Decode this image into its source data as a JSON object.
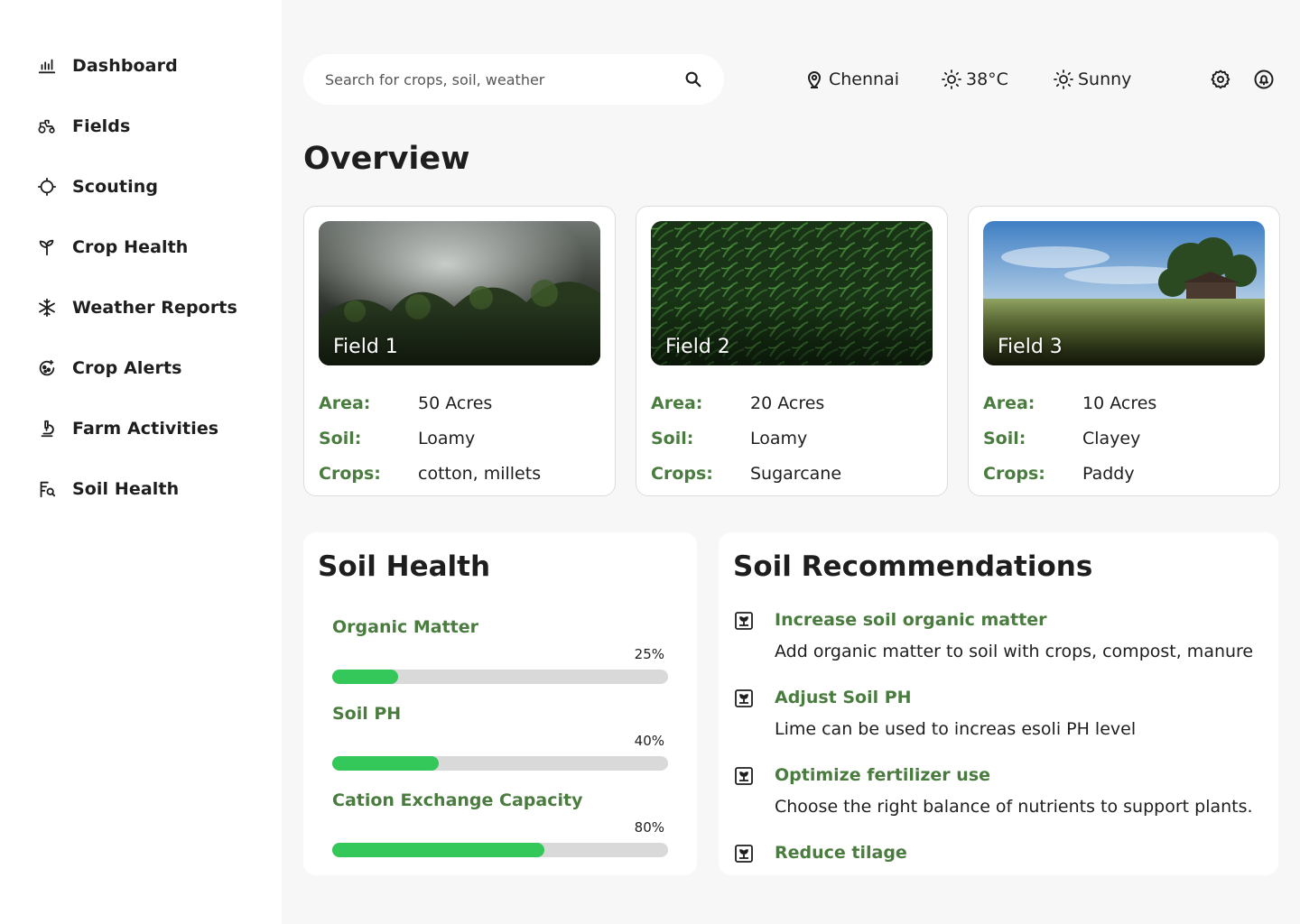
{
  "sidebar": {
    "items": [
      {
        "label": "Dashboard",
        "icon": "bar-chart-icon"
      },
      {
        "label": "Fields",
        "icon": "tractor-icon"
      },
      {
        "label": "Scouting",
        "icon": "crosshair-icon"
      },
      {
        "label": "Crop Health",
        "icon": "sprout-icon"
      },
      {
        "label": "Weather Reports",
        "icon": "snowflake-icon"
      },
      {
        "label": "Crop Alerts",
        "icon": "alert-icon"
      },
      {
        "label": "Farm Activities",
        "icon": "microscope-icon"
      },
      {
        "label": "Soil Health",
        "icon": "soil-search-icon"
      }
    ]
  },
  "search": {
    "placeholder": "Search for crops, soil, weather"
  },
  "header": {
    "location": "Chennai",
    "temperature": "38°C",
    "condition": "Sunny"
  },
  "overview": {
    "title": "Overview"
  },
  "fields": [
    {
      "name": "Field 1",
      "area_key": "Area:",
      "area": "50 Acres",
      "soil_key": "Soil:",
      "soil": "Loamy",
      "crops_key": "Crops:",
      "crops": "cotton, millets"
    },
    {
      "name": "Field 2",
      "area_key": "Area:",
      "area": "20 Acres",
      "soil_key": "Soil:",
      "soil": "Loamy",
      "crops_key": "Crops:",
      "crops": "Sugarcane"
    },
    {
      "name": "Field 3",
      "area_key": "Area:",
      "area": "10 Acres",
      "soil_key": "Soil:",
      "soil": "Clayey",
      "crops_key": "Crops:",
      "crops": "Paddy"
    }
  ],
  "soil_health": {
    "title": "Soil Health",
    "metrics": [
      {
        "label": "Organic Matter",
        "percent": "25%",
        "value": 25
      },
      {
        "label": "Soil PH",
        "percent": "40%",
        "value": 40
      },
      {
        "label": "Cation Exchange Capacity",
        "percent": "80%",
        "value": 80
      }
    ]
  },
  "recommendations": {
    "title": "Soil Recommendations",
    "items": [
      {
        "title": "Increase soil organic matter",
        "desc": "Add organic matter to soil with crops, compost, manure"
      },
      {
        "title": "Adjust Soil PH",
        "desc": "Lime can be used to increas esoli PH level"
      },
      {
        "title": "Optimize fertilizer use",
        "desc": "Choose the right balance of nutrients to support plants."
      },
      {
        "title": "Reduce tilage",
        "desc": ""
      }
    ]
  },
  "colors": {
    "accent_green": "#4a7c3f",
    "progress_green": "#34c759",
    "progress_track": "#d9d9d9"
  }
}
